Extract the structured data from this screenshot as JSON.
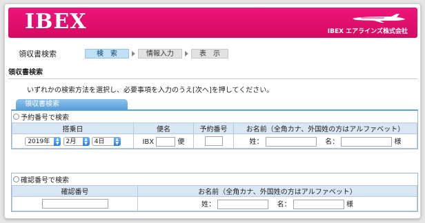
{
  "header": {
    "logo": "IBEX",
    "brand": "IBEX エアラインズ株式会社",
    "colors": {
      "brand": "#e0106e",
      "tab": "#5b9fd8",
      "table_head": "#d9e7f4"
    }
  },
  "steps": {
    "title": "領収書検索",
    "items": [
      {
        "label": "検　索",
        "active": true
      },
      {
        "label": "情報入力",
        "active": false
      },
      {
        "label": "表　示",
        "active": false
      }
    ]
  },
  "section_title": "領収書検索",
  "instruction": "いずれかの検索方法を選択し、必要事項を入力のうえ[次へ]を押してください。",
  "panel_tab": "領収書検索",
  "reservation": {
    "option_label": "予約番号で検索",
    "headers": {
      "date": "搭乗日",
      "flight": "便名",
      "reservation_no": "予約番号",
      "name": "お名前（全角カナ、外国姓の方はアルファベット）"
    },
    "year": "2019年",
    "month": "2月",
    "day": "4日",
    "flight_prefix": "IBX",
    "flight_suffix": "便",
    "surname_label": "姓：",
    "given_label": "名：",
    "honorific": "様"
  },
  "confirmation": {
    "option_label": "確認番号で検索",
    "headers": {
      "confirmation_no": "確認番号",
      "name": "お名前（全角カナ、外国姓の方はアルファベット）"
    },
    "surname_label": "姓：",
    "given_label": "名：",
    "honorific": "様"
  }
}
